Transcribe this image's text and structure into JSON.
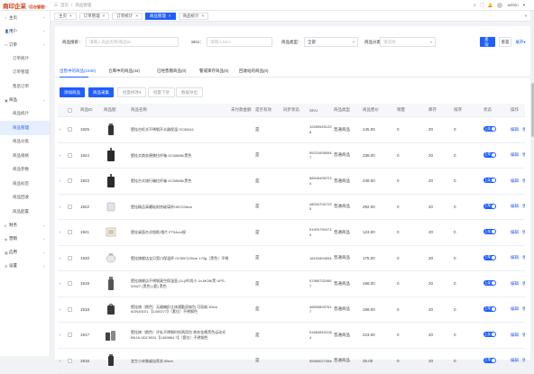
{
  "header": {
    "logo_text": "商印企采",
    "logo_sub": "（后台管理）",
    "breadcrumb": [
      "首页",
      "商品管理"
    ],
    "user_name": "admin"
  },
  "sidebar": {
    "items": [
      {
        "icon": "⌂",
        "label": "主页"
      },
      {
        "icon": "👤",
        "label": "用户"
      },
      {
        "icon": "▭",
        "label": "订单",
        "children": [
          "订单统计",
          "订单管理",
          "售后订单"
        ]
      },
      {
        "icon": "▣",
        "label": "商品",
        "children": [
          "商品统计",
          "商品管理",
          "商品分类",
          "商品规格",
          "商品参数",
          "商品标签",
          "商品回收",
          "商品配置"
        ],
        "active_child": "商品管理"
      },
      {
        "icon": "¥",
        "label": "财务"
      },
      {
        "icon": "◈",
        "label": "营销"
      },
      {
        "icon": "▦",
        "label": "应用"
      },
      {
        "icon": "⚙",
        "label": "设置"
      }
    ]
  },
  "tabs": [
    {
      "label": "主页"
    },
    {
      "label": "订单管理"
    },
    {
      "label": "订单统计"
    },
    {
      "label": "商品管理",
      "active": true
    },
    {
      "label": "商品统计"
    }
  ],
  "filter": {
    "name_label": "商品搜索：",
    "name_placeholder": "请输入商品名称/商品ID",
    "sku_label": "SKU：",
    "sku_placeholder": "请输入SKU",
    "type_label": "商品类型：",
    "type_value": "全部",
    "cat_label": "商品分类：",
    "cat_placeholder": "请选择",
    "search_btn": "查询",
    "reset_btn": "重置",
    "expand_btn": "展开"
  },
  "status_tabs": [
    {
      "label": "出售中的商品(1530)",
      "active": true
    },
    {
      "label": "仓库中的商品(44)"
    },
    {
      "label": "已经售罄商品(0)"
    },
    {
      "label": "警戒库存商品(0)"
    },
    {
      "label": "回收站的商品(0)"
    }
  ],
  "actions": {
    "add": "添加商品",
    "import": "商品采集",
    "batch_edit": "批量修改",
    "batch_offline": "批量下架",
    "export": "数据导出"
  },
  "table": {
    "headers": [
      "商品ID",
      "商品图",
      "商品名称",
      "未付款金额",
      "是否有效",
      "同步状态",
      "SKU",
      "商品类型",
      "商品售价",
      "销量",
      "库存",
      "排序",
      "状态",
      "操作"
    ],
    "switch_text": "上架",
    "edit": "编辑",
    "more": "更多",
    "rows": [
      {
        "id": "1925",
        "thumb": "cup",
        "name": "壁挂台柜式不锈钢开水器保温 OC58411",
        "valid": "是",
        "sku": "1928954512258 8",
        "type": "普通商品",
        "price": "145.00",
        "sales": "0",
        "stock": "20",
        "sort": "0"
      },
      {
        "id": "1924",
        "thumb": "luggage",
        "name": "壁挂式商务便携拉杆箱 OC58696/黑色",
        "valid": "是",
        "sku": "5923169559446 7",
        "type": "普通商品",
        "price": "238.00",
        "sales": "0",
        "stock": "20",
        "sort": "0"
      },
      {
        "id": "1923",
        "thumb": "luggage",
        "name": "壁挂台式旅行箱拉杆箱 OC58696/黑色",
        "valid": "是",
        "sku": "5854549572164 4",
        "type": "普通商品",
        "price": "238.00",
        "sales": "0",
        "stock": "20",
        "sort": "0"
      },
      {
        "id": "1922",
        "thumb": "glass",
        "name": "壁挂精品高硼硅耐热玻璃杯OB7228cm",
        "valid": "是",
        "sku": "4803470072255 5",
        "type": "普通商品",
        "price": "292.00",
        "sales": "0",
        "stock": "20",
        "sort": "0"
      },
      {
        "id": "1921",
        "thumb": "frame",
        "name": "壁挂桌面台式相框/相片 FT54cm规",
        "valid": "是",
        "sku": "5190079047113 9",
        "type": "普通商品",
        "price": "123.00",
        "sales": "0",
        "stock": "20",
        "sort": "0"
      },
      {
        "id": "1920",
        "thumb": "pot",
        "name": "壁挂旗舰店宝贝宽口保温杯 OC5B7229cm 170g（黑色）不锈",
        "valid": "是",
        "sku": "1815289459421",
        "type": "普通商品",
        "price": "175.00",
        "sales": "0",
        "stock": "20",
        "sort": "0"
      },
      {
        "id": "1919",
        "thumb": "flask",
        "name": "壁挂旗舰店不锈钢真空保温壶 (1L)/时尚小 Jn-MOB/黑 UPS-03927 (黑色) (套) 黑色",
        "valid": "是",
        "sku": "5798973245570 7",
        "type": "普通商品",
        "price": "198.00",
        "sales": "0",
        "stock": "20",
        "sort": "0"
      },
      {
        "id": "1918",
        "thumb": "bag",
        "name": "壁挂旗（颜色）无缝编织立体通勤双肩包 可双肩 30cm 6ON30101 【1400277】（套位）不锈钢色",
        "valid": "是",
        "sku": "4859989376127 7",
        "type": "普通商品",
        "price": "198.00",
        "sales": "0",
        "stock": "20",
        "sort": "0"
      },
      {
        "id": "1917",
        "thumb": "mix",
        "name": "壁挂旗（颜色）冷轧不锈钢时尚两用包 商务金属黑色运动式 BKJA-XDC9931【1409884 7】（套位）不锈钢色",
        "valid": "是",
        "sku": "5168484011524 4",
        "type": "普通商品",
        "price": "223.00",
        "sales": "0",
        "stock": "20",
        "sort": "0"
      },
      {
        "id": "1916",
        "thumb": "cup",
        "name": "宜生小米餐桌店家务 85cm",
        "valid": "是",
        "sku": "5558902735467",
        "type": "普通商品",
        "price": "25.00",
        "sales": "0",
        "stock": "20",
        "sort": "0"
      }
    ]
  }
}
